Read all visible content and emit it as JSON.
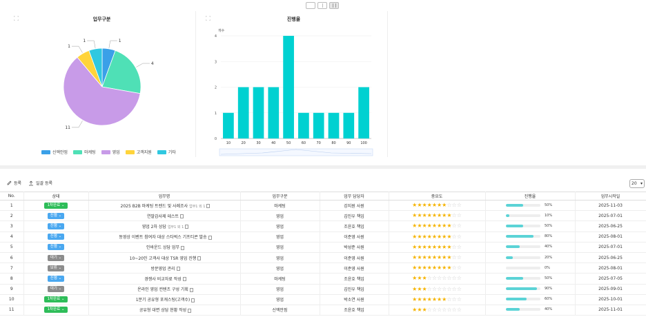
{
  "colors": {
    "status_done": "#2ebd59",
    "status_progress": "#4aa8f0",
    "status_wait": "#8c8c8c",
    "status_hold": "#8c8c8c",
    "bar": "#00d1d1",
    "accent_fill": "#5bd3d6",
    "star": "#f5b301"
  },
  "view_toggles": [
    "single-view-icon",
    "split-view-icon",
    "triple-view-icon"
  ],
  "charts": {
    "pie": {
      "title": "업무구분",
      "legend": [
        {
          "name": "신액안핌",
          "color": "#3aa0e8"
        },
        {
          "name": "마케팅",
          "color": "#4fe0b6"
        },
        {
          "name": "영업",
          "color": "#c89be8"
        },
        {
          "name": "고객지원",
          "color": "#ffd43b"
        },
        {
          "name": "기타",
          "color": "#30c8e0"
        }
      ]
    },
    "bar": {
      "title": "진행율",
      "ylabel": "개수"
    }
  },
  "chart_data": [
    {
      "type": "pie",
      "title": "업무구분",
      "slices": [
        {
          "name": "신액안핌",
          "value": 1,
          "color": "#3aa0e8"
        },
        {
          "name": "마케팅",
          "value": 4,
          "color": "#4fe0b6"
        },
        {
          "name": "영업",
          "value": 11,
          "color": "#c89be8"
        },
        {
          "name": "고객지원",
          "value": 1,
          "color": "#ffd43b"
        },
        {
          "name": "기타",
          "value": 1,
          "color": "#30c8e0"
        }
      ],
      "legend_position": "bottom"
    },
    {
      "type": "bar",
      "title": "진행율",
      "ylabel": "개수",
      "categories": [
        "10",
        "20",
        "30",
        "40",
        "50",
        "60",
        "70",
        "80",
        "90",
        "100"
      ],
      "values": [
        1,
        2,
        2,
        2,
        4,
        1,
        1,
        1,
        1,
        2
      ],
      "ylim": [
        0,
        4
      ],
      "yticks": [
        "0",
        "1",
        "2",
        "3",
        "4"
      ],
      "color": "#00d1d1",
      "grid": true
    }
  ],
  "toolbar": {
    "register_label": "등록",
    "bulk_label": "일괄 등록",
    "page_size": "20"
  },
  "table": {
    "headers": [
      "No.",
      "상태",
      "업무명",
      "업무구분",
      "업무 담당자",
      "중요도",
      "진행율",
      "업무시작일"
    ],
    "rows": [
      {
        "no": "1",
        "status": "1차완료",
        "status_kind": "done",
        "name": "2025 B2B 마케팅 트렌드 및 사례조사",
        "note": "업무1 외 1",
        "cat": "마케팅",
        "owner": "강지원 사원",
        "stars": 7,
        "progress": "50%",
        "pct": 50,
        "date": "2025-11-03"
      },
      {
        "no": "2",
        "status": "진행",
        "status_kind": "progress",
        "name": "연말감사제 테스트",
        "note": "",
        "cat": "영업",
        "owner": "김민우 책임",
        "stars": 8,
        "progress": "10%",
        "pct": 10,
        "date": "2025-07-01"
      },
      {
        "no": "3",
        "status": "진행",
        "status_kind": "progress",
        "name": "영업 2차 상담",
        "note": "업무1 외 1",
        "cat": "영업",
        "owner": "조윤호 책임",
        "stars": 8,
        "progress": "50%",
        "pct": 50,
        "date": "2025-06-25"
      },
      {
        "no": "4",
        "status": "진행",
        "status_kind": "progress",
        "name": "동영상 이벤트 참여자 대상 스타벅스 기프티콘 발송",
        "note": "",
        "cat": "영업",
        "owner": "이준영 사원",
        "stars": 8,
        "progress": "80%",
        "pct": 80,
        "date": "2025-08-01"
      },
      {
        "no": "5",
        "status": "진행",
        "status_kind": "progress",
        "name": "인바운드 상담 업무",
        "note": "",
        "cat": "영업",
        "owner": "박성준 사원",
        "stars": 8,
        "progress": "40%",
        "pct": 40,
        "date": "2025-07-01"
      },
      {
        "no": "6",
        "status": "대기",
        "status_kind": "wait",
        "name": "10~20인 고객사 대상 TSR 영업 진행",
        "note": "",
        "cat": "영업",
        "owner": "이준영 사원",
        "stars": 8,
        "progress": "20%",
        "pct": 20,
        "date": "2025-06-25"
      },
      {
        "no": "7",
        "status": "보류",
        "status_kind": "hold",
        "name": "방문영업 관리",
        "note": "",
        "cat": "영업",
        "owner": "이준영 사원",
        "stars": 8,
        "progress": "0%",
        "pct": 0,
        "date": "2025-08-01"
      },
      {
        "no": "8",
        "status": "진행",
        "status_kind": "progress",
        "name": "경쟁사 비교자료 작성",
        "note": "",
        "cat": "마케팅",
        "owner": "조윤호 책임",
        "stars": 3,
        "progress": "50%",
        "pct": 50,
        "date": "2025-07-05"
      },
      {
        "no": "9",
        "status": "대기",
        "status_kind": "wait",
        "name": "온라인 영업 컨텐츠 구성 기획",
        "note": "",
        "cat": "영업",
        "owner": "김민우 책임",
        "stars": 3,
        "progress": "90%",
        "pct": 90,
        "date": "2025-09-01"
      },
      {
        "no": "10",
        "status": "1차완료",
        "status_kind": "done",
        "name": "1분기 공유형 포캐스팅(고객수)",
        "note": "",
        "cat": "영업",
        "owner": "박소연 사원",
        "stars": 7,
        "progress": "60%",
        "pct": 60,
        "date": "2025-10-01"
      },
      {
        "no": "11",
        "status": "1차완료",
        "status_kind": "done",
        "name": "공유형 대면 상담 현황 작성",
        "note": "",
        "cat": "신액안핌",
        "owner": "조윤호 책임",
        "stars": 3,
        "progress": "40%",
        "pct": 40,
        "date": "2025-11-01"
      }
    ]
  }
}
